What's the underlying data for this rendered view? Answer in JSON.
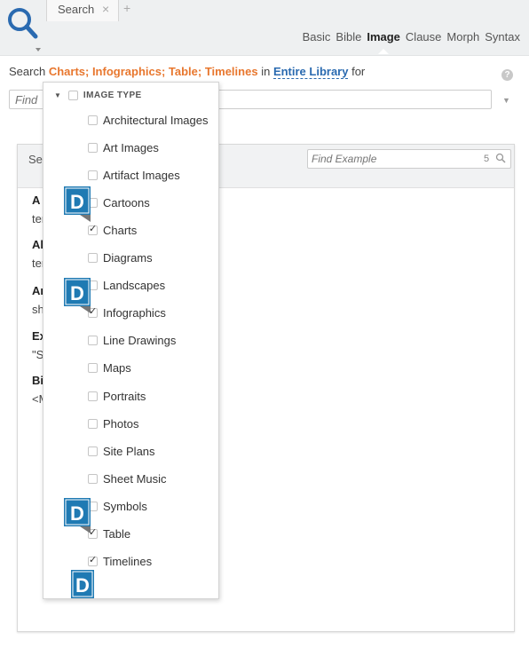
{
  "header": {
    "tab_label": "Search",
    "tab_close": "×",
    "tab_add": "+",
    "modes": [
      "Basic",
      "Bible",
      "Image",
      "Clause",
      "Morph",
      "Syntax"
    ],
    "active_mode": "Image"
  },
  "search_line": {
    "prefix": "Search",
    "types": "Charts; Infographics; Table; Timelines",
    "in_word": "in",
    "scope": "Entire Library",
    "suffix": "for"
  },
  "find": {
    "placeholder": "Find"
  },
  "panel": {
    "title_partial": "Sea",
    "find_example_placeholder": "Find Example",
    "find_example_count": "5",
    "snippets": [
      {
        "title": "A V",
        "sub": "ter"
      },
      {
        "title": "All",
        "sub": "ter"
      },
      {
        "title": "An",
        "sub": "sh"
      },
      {
        "title": "Ex",
        "sub": "\"S"
      },
      {
        "title": "Bil",
        "sub": "<M"
      }
    ]
  },
  "dropdown": {
    "header": "IMAGE TYPE",
    "items": [
      {
        "label": "Architectural Images",
        "checked": false
      },
      {
        "label": "Art Images",
        "checked": false
      },
      {
        "label": "Artifact Images",
        "checked": false
      },
      {
        "label": "Cartoons",
        "checked": false
      },
      {
        "label": "Charts",
        "checked": true
      },
      {
        "label": "Diagrams",
        "checked": false
      },
      {
        "label": "Landscapes",
        "checked": false
      },
      {
        "label": "Infographics",
        "checked": true
      },
      {
        "label": "Line Drawings",
        "checked": false
      },
      {
        "label": "Maps",
        "checked": false
      },
      {
        "label": "Portraits",
        "checked": false
      },
      {
        "label": "Photos",
        "checked": false
      },
      {
        "label": "Site Plans",
        "checked": false
      },
      {
        "label": "Sheet Music",
        "checked": false
      },
      {
        "label": "Symbols",
        "checked": false
      },
      {
        "label": "Table",
        "checked": true
      },
      {
        "label": "Timelines",
        "checked": true
      }
    ]
  },
  "colors": {
    "orange": "#e8772e",
    "blue": "#2a6ab0",
    "logo_blue": "#1f7ab3"
  },
  "icons": {
    "search": "magnifier-icon",
    "logo": "d-logo-icon"
  }
}
